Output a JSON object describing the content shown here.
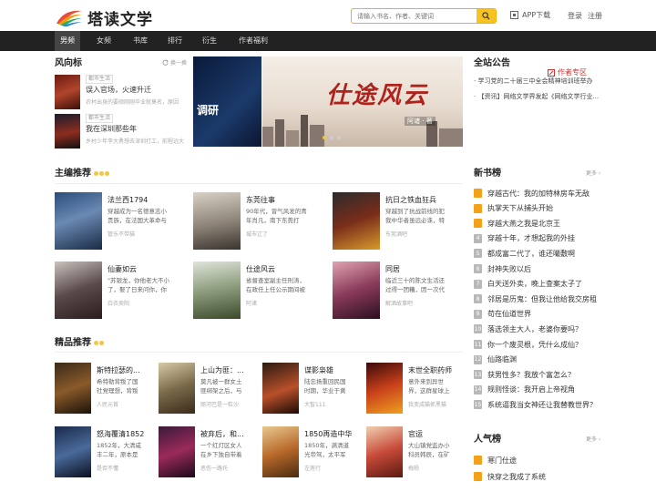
{
  "header": {
    "logo_text": "塔读文学",
    "search_placeholder": "请输入书名、作者、关键词",
    "app_download": "APP下载",
    "login": "登录",
    "register": "注册"
  },
  "nav": {
    "items": [
      "男频",
      "女频",
      "书库",
      "排行",
      "衍生",
      "作者福利"
    ],
    "author_zone": "作者专区"
  },
  "fengxiang": {
    "title": "风向标",
    "change": "换一换",
    "items": [
      {
        "tag": "都市生活",
        "title": "误入官场，火速升迁",
        "desc": "农村出身的要硕刚刚毕业就莫名，原因"
      },
      {
        "tag": "都市生活",
        "title": "我在深圳那些年",
        "desc": "乡村少年李大勇想去深圳打工，前程远大"
      }
    ]
  },
  "banner": {
    "left_text": "调研",
    "title": "仕途风云",
    "author": "阿诸 · 著"
  },
  "notice": {
    "title": "全站公告",
    "items": [
      "学习党的二十届三中全会精神培训班举办",
      "【资讯】网络文学界发起《网络文学行业..."
    ]
  },
  "editor_pick": {
    "title": "主编推荐",
    "books": [
      {
        "title": "法兰西1794",
        "desc": "穿越成为一名德意志小贵族，在法国大革命与拿破仑时代",
        "author": "管乐不带猫"
      },
      {
        "title": "东莞往事",
        "desc": "90年代，曾气风发的青年肖凡，南下东莞打工，邂逅了",
        "author": "城市辽了"
      },
      {
        "title": "抗日之铁血狂兵",
        "desc": "穿越到了抗战前线的犯我中华者虽远必诛，特种兵赵志国",
        "author": "东莞酒吧"
      },
      {
        "title": "仙妻如云",
        "desc": "\"苏银龙，你他老大不小了，娶了日来问你，你要选",
        "author": "白衣卖阳"
      },
      {
        "title": "仕途风云",
        "desc": "省督查室副主任刑涛，在政任上任公示期间被举报，首",
        "author": "阿诸"
      },
      {
        "title": "同居",
        "desc": "临近三十的陈文生活还过得一团糟，因一次代驾撞车被",
        "author": "解酒故事吧"
      }
    ]
  },
  "quality": {
    "title": "精品推荐",
    "books": [
      {
        "title": "斯特拉瑟的...",
        "desc": "希特勒背叛了国社党理想，背叛",
        "author": "人民元首"
      },
      {
        "title": "上山为匪：...",
        "desc": "莫凡被一群女土匪绑架之后，与",
        "author": "丽河巴是一粒沙"
      },
      {
        "title": "谍影枭雄",
        "desc": "陆忠扬重回民国时期，华业于黄",
        "author": "大智111"
      },
      {
        "title": "末世全职药师",
        "desc": "意外来到异世界，这群星球上的",
        "author": "我变成猫抓黑猫"
      },
      {
        "title": "怒海覆清1852",
        "desc": "1852年，大清咸丰二年，原本是",
        "author": "是否不懂"
      },
      {
        "title": "被弃后，和...",
        "desc": "一个红灯区女人在乡下独自带着",
        "author": "恶伤一路托"
      },
      {
        "title": "1850再造中华",
        "desc": "1850年，满清道光帝驾，太平军",
        "author": "左莲行"
      },
      {
        "title": "官运",
        "desc": "大山镇党监办小科员韩辰，在矿",
        "author": "梅杨"
      }
    ]
  },
  "new_books": {
    "title": "新书榜",
    "more": "更多",
    "items": [
      "穿越古代：我的加特林房车无敌",
      "执掌天下从捕头开始",
      "穿越大燕之我是北京王",
      "穿越十年，才想起我的外挂",
      "都成富二代了，谁还嘬敷啊",
      "封神失败以后",
      "白天送外卖，晚上查案太子了",
      "邻居是历鬼：但我让他给我交房租",
      "苟在仙道世界",
      "落选领主大人，老婆你要吗？",
      "你一个废灵根，凭什么成仙？",
      "仙路临渊",
      "获男性多？我放个富怎么？",
      "规则怪谈：我开启上帝视角",
      "系统逼我当女神还让我替教世界？"
    ]
  },
  "popular": {
    "title": "人气榜",
    "more": "更多",
    "items": [
      "寒门仕途",
      "快穿之我成了系统"
    ]
  },
  "colors": {
    "accent": "#f7c320",
    "nav_bg": "#222222",
    "rank_top": "#f4a11a",
    "rank_other": "#b8b8b8"
  }
}
